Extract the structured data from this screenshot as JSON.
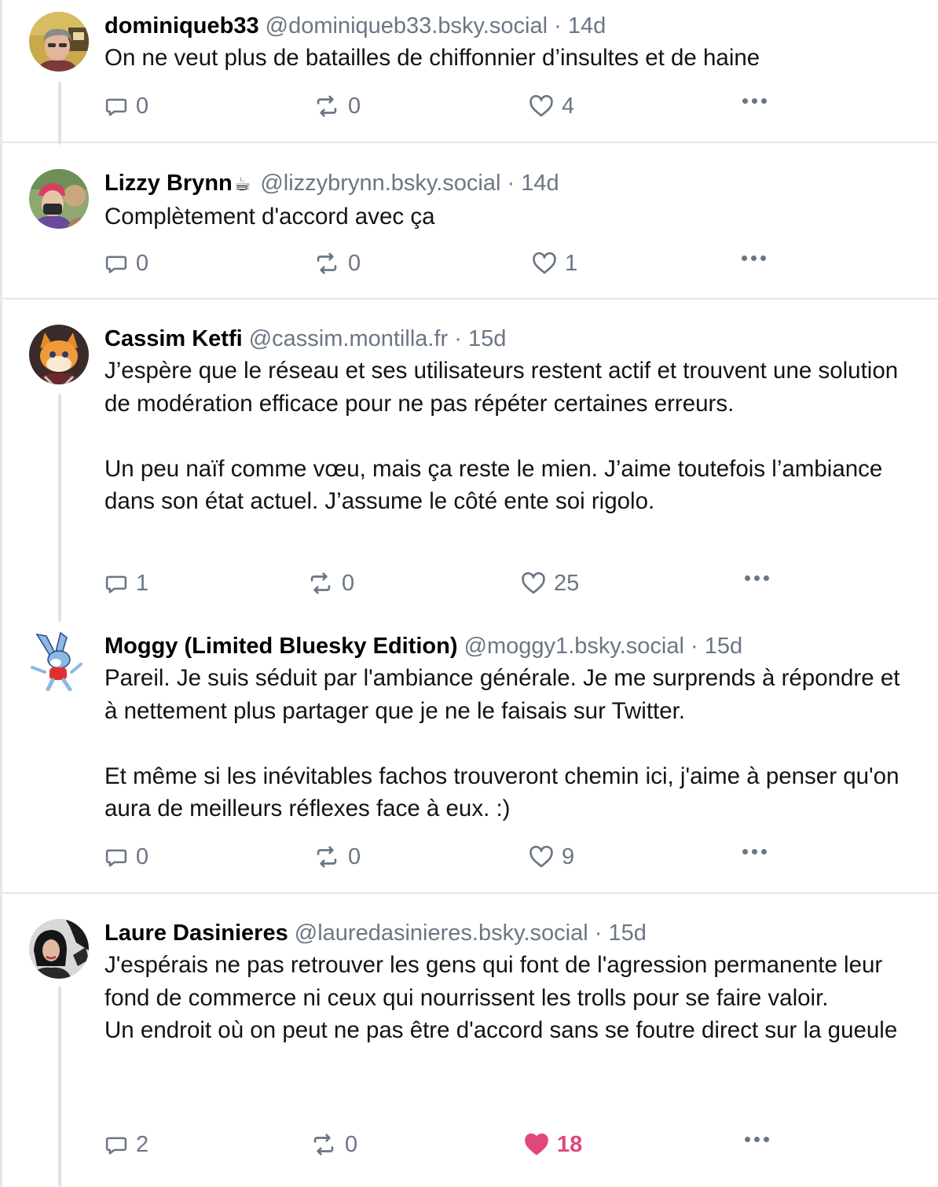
{
  "posts": [
    {
      "name": "dominiqueb33",
      "handle": "@dominiqueb33.bsky.social",
      "sep": "·",
      "time": "14d",
      "paragraphs": [
        "On ne veut plus de batailles de chiffonnier d’insultes et de haine"
      ],
      "reply_count": "0",
      "repost_count": "0",
      "like_count": "4"
    },
    {
      "name": "Lizzy Brynn",
      "name_emoji": "☕",
      "handle": "@lizzybrynn.bsky.social",
      "sep": "·",
      "time": "14d",
      "paragraphs": [
        "Complètement d'accord avec ça"
      ],
      "reply_count": "0",
      "repost_count": "0",
      "like_count": "1"
    },
    {
      "name": "Cassim Ketfi",
      "handle": "@cassim.montilla.fr",
      "sep": "·",
      "time": "15d",
      "paragraphs": [
        "J’espère que le réseau et ses utilisateurs restent actif et trouvent une solution de modération efficace pour ne pas répéter certaines erreurs.",
        "Un peu naïf comme vœu, mais ça reste le mien. J’aime toutefois l’ambiance dans son état actuel. J’assume le côté ente soi rigolo."
      ],
      "reply_count": "1",
      "repost_count": "0",
      "like_count": "25"
    },
    {
      "name": "Moggy (Limited Bluesky Edition)",
      "handle": "@moggy1.bsky.social",
      "sep": "·",
      "time": "15d",
      "paragraphs": [
        "Pareil. Je suis séduit par l'ambiance générale. Je me surprends à répondre et à nettement plus partager que je ne le faisais sur Twitter.",
        "Et même si les inévitables fachos trouveront chemin ici, j'aime à penser qu'on aura de meilleurs réflexes face à eux. :)"
      ],
      "reply_count": "0",
      "repost_count": "0",
      "like_count": "9"
    },
    {
      "name": "Laure Dasinieres",
      "handle": "@lauredasinieres.bsky.social",
      "sep": "·",
      "time": "15d",
      "paragraphs": [
        "J'espérais ne pas retrouver les gens qui font de l'agression permanente leur fond de commerce ni ceux qui nourrissent les trolls pour se faire valoir.\nUn endroit où on peut ne pas être d'accord sans se foutre direct sur la gueule"
      ],
      "reply_count": "2",
      "repost_count": "0",
      "like_count": "18",
      "liked": true
    }
  ],
  "colors": {
    "muted": "#6b7684",
    "like_active": "#e0487a",
    "thread_line": "#dee2e6",
    "separator": "#e5e8eb"
  }
}
